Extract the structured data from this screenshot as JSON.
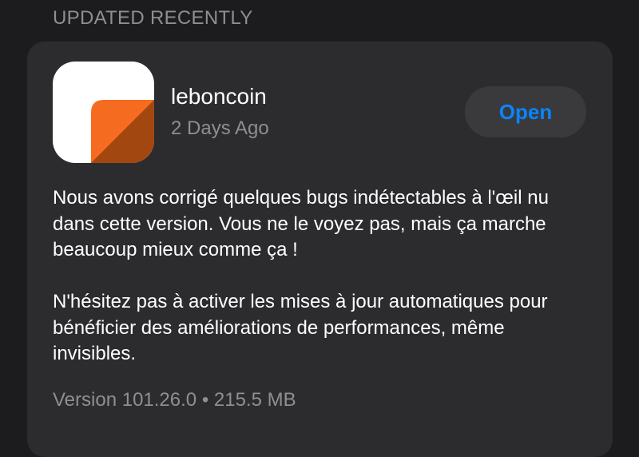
{
  "section": {
    "title": "UPDATED RECENTLY"
  },
  "app": {
    "name": "leboncoin",
    "date": "2 Days Ago",
    "icon": "leboncoin-app-icon",
    "button_label": "Open",
    "release_notes": [
      "Nous avons corrigé quelques bugs indétectables à l'œil nu dans cette version. Vous ne le voyez pas, mais ça marche beaucoup mieux comme ça !",
      "N'hésitez pas à activer les mises à jour automatiques pour bénéficier des améliorations de performances, même invisibles."
    ],
    "version": "Version 101.26.0",
    "separator": "•",
    "size": "215.5 MB"
  },
  "colors": {
    "background": "#1c1c1e",
    "card": "#2c2c2e",
    "button_bg": "#3a3a3c",
    "accent": "#0a84ff",
    "secondary_text": "#8e8e93",
    "icon_orange": "#f56b1f",
    "icon_orange_dark": "#a34710"
  }
}
